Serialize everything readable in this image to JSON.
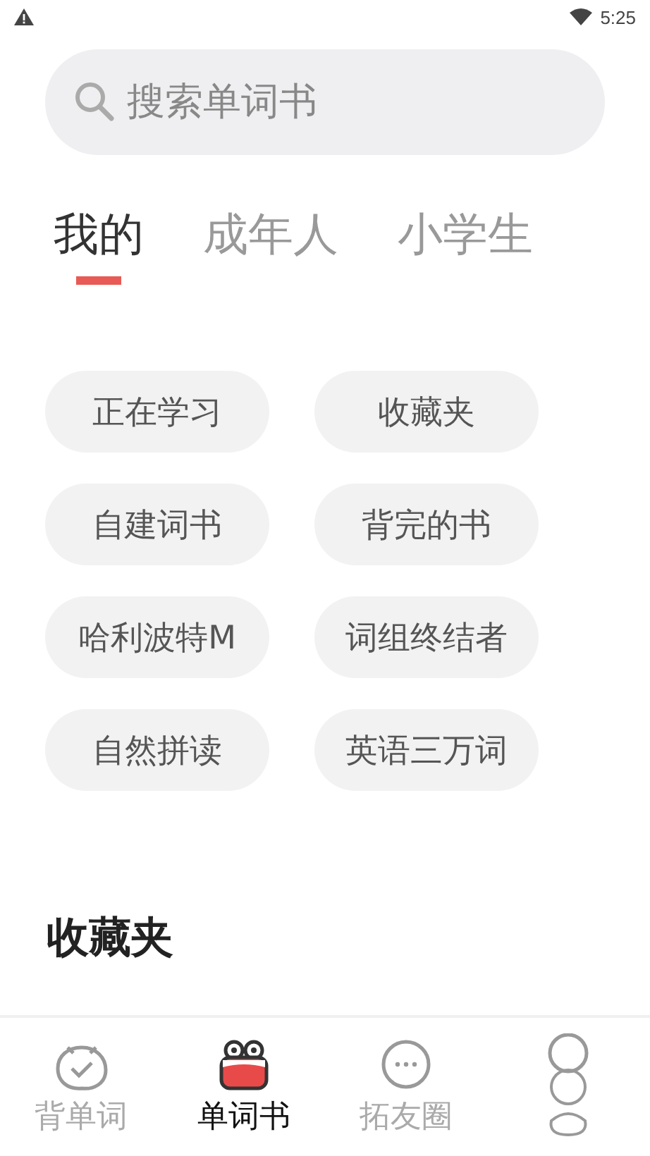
{
  "status_bar": {
    "time": "5:25"
  },
  "search": {
    "placeholder": "搜索单词书"
  },
  "tabs": [
    {
      "label": "我的",
      "selected": true
    },
    {
      "label": "成年人",
      "selected": false
    },
    {
      "label": "小学生",
      "selected": false
    }
  ],
  "chips": [
    "正在学习",
    "收藏夹",
    "自建词书",
    "背完的书",
    "哈利波特M",
    "词组终结者",
    "自然拼读",
    "英语三万词"
  ],
  "section_title": "收藏夹",
  "bottom_nav": [
    {
      "label": "背单词",
      "kind": "clock",
      "selected": false
    },
    {
      "label": "单词书",
      "kind": "book",
      "selected": true
    },
    {
      "label": "拓友圈",
      "kind": "chat",
      "selected": false
    },
    {
      "kind": "avatar",
      "selected": false
    }
  ]
}
